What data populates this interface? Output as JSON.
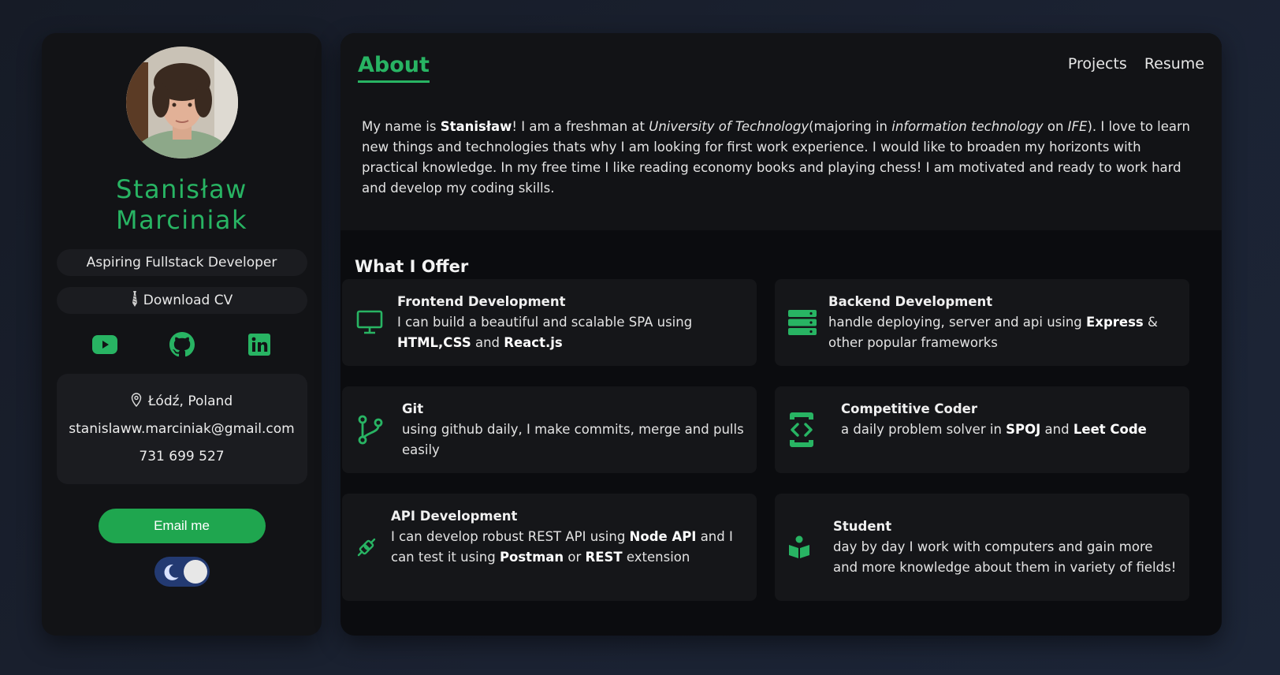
{
  "profile": {
    "first_name": "Stanisław",
    "last_name": "Marciniak",
    "role": "Aspiring Fullstack Developer",
    "download_cv": "Download CV",
    "location": "Łódź, Poland",
    "email": "stanislaww.marciniak@gmail.com",
    "phone": "731 699 527",
    "email_button": "Email me",
    "socials": [
      "youtube-icon",
      "github-icon",
      "linkedin-icon"
    ],
    "theme_toggle": "dark"
  },
  "nav": {
    "active": "About",
    "links": [
      "Projects",
      "Resume"
    ]
  },
  "about": {
    "p1": "My name is ",
    "name": "Stanisław",
    "p2": "! I am a freshman at ",
    "university": "University of Technology",
    "p3": "(majoring in ",
    "major": "information technology",
    "p4": " on ",
    "faculty": "IFE",
    "p5": "). I love to learn new things and technologies thats why I am looking for first work experience. I would like to broaden my horizonts with practical knowledge. In my free time I like reading economy books and playing chess! I am motivated and ready to work hard and develop my coding skills."
  },
  "offer": {
    "title": "What I Offer",
    "frontend": {
      "title": "Frontend Development",
      "t1": "I can build a beautiful and scalable SPA using ",
      "b1": "HTML,CSS",
      "t2": " and ",
      "b2": "React.js"
    },
    "backend": {
      "title": "Backend Development",
      "t1": "handle deploying, server and api using ",
      "b1": "Express",
      "t2": " & other popular frameworks"
    },
    "git": {
      "title": "Git",
      "t1": "using github daily, I make commits, merge and pulls easily"
    },
    "coder": {
      "title": "Competitive Coder",
      "t1": "a daily problem solver in ",
      "b1": "SPOJ",
      "t2": " and ",
      "b2": "Leet Code"
    },
    "api": {
      "title": "API Development",
      "t1": "I can develop robust REST API using ",
      "b1": "Node API",
      "t2": " and I can test it using ",
      "b2": "Postman",
      "t3": " or ",
      "b3": "REST",
      "t4": " extension"
    },
    "student": {
      "title": "Student",
      "t1": "day by day I work with computers and gain more and more knowledge about them in variety of fields!"
    }
  },
  "colors": {
    "accent": "#28b463",
    "button": "#1fa64f",
    "toggle": "#233a72"
  }
}
